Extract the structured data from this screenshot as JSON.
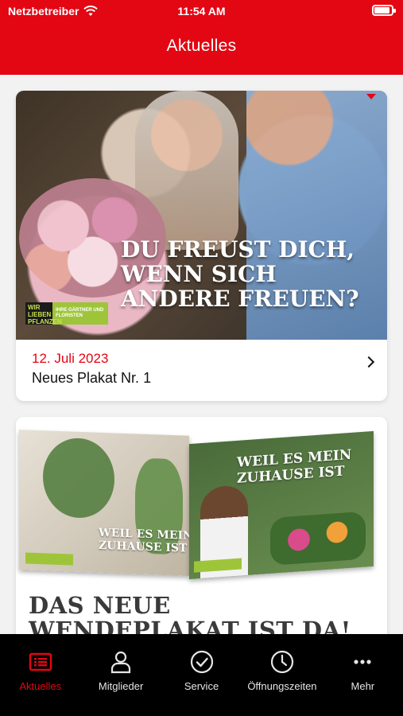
{
  "status_bar": {
    "carrier": "Netzbetreiber",
    "time": "11:54 AM"
  },
  "header": {
    "title": "Aktuelles"
  },
  "colors": {
    "accent": "#e30613",
    "tabbar": "#000000"
  },
  "posts": [
    {
      "image_headline": "DU FREUST DICH, WENN SICH ANDERE FREUEN?",
      "image_logo": {
        "mark": "WIR LIEBEN PFLANZEN",
        "sub": "IHRE GÄRTNER UND FLORISTEN"
      },
      "date": "12. Juli 2023",
      "title": "Neues Plakat Nr. 1"
    },
    {
      "image_poster_a_text": "WEIL ES MEIN ZUHAUSE IST",
      "image_poster_b_text": "WEIL ES MEIN ZUHAUSE IST",
      "headline": "DAS NEUE WENDEPLAKAT IST DA!"
    }
  ],
  "tabs": [
    {
      "label": "Aktuelles",
      "icon": "news-list-icon",
      "active": true
    },
    {
      "label": "Mitglieder",
      "icon": "person-icon",
      "active": false
    },
    {
      "label": "Service",
      "icon": "checkmark-circle-icon",
      "active": false
    },
    {
      "label": "Öffnungszeiten",
      "icon": "clock-icon",
      "active": false
    },
    {
      "label": "Mehr",
      "icon": "more-dots-icon",
      "active": false
    }
  ]
}
